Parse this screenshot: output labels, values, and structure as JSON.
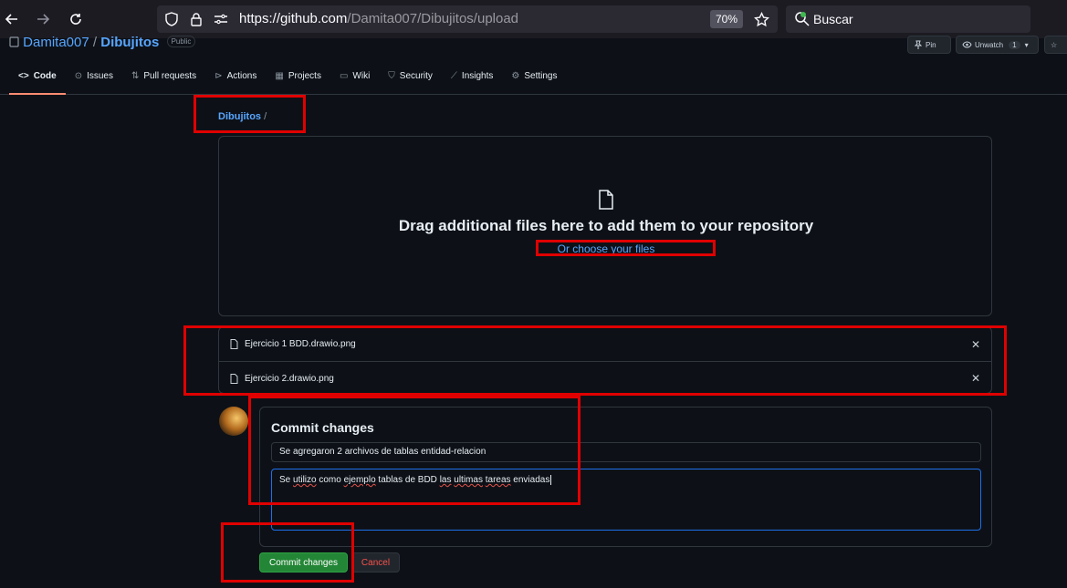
{
  "browser": {
    "url_host": "https://github.com",
    "url_path": "/Damita007/Dibujitos/upload",
    "zoom": "70%",
    "search_placeholder": "Buscar"
  },
  "repo": {
    "owner": "Damita007",
    "separator": " / ",
    "name": "Dibujitos",
    "visibility": "Public",
    "pin_label": "Pin",
    "unwatch_label": "Unwatch",
    "watch_count": "1"
  },
  "tabs": [
    {
      "label": "Code",
      "icon": "code-icon"
    },
    {
      "label": "Issues",
      "icon": "issue-icon"
    },
    {
      "label": "Pull requests",
      "icon": "pull-request-icon"
    },
    {
      "label": "Actions",
      "icon": "play-icon"
    },
    {
      "label": "Projects",
      "icon": "table-icon"
    },
    {
      "label": "Wiki",
      "icon": "book-icon"
    },
    {
      "label": "Security",
      "icon": "shield-icon"
    },
    {
      "label": "Insights",
      "icon": "graph-icon"
    },
    {
      "label": "Settings",
      "icon": "gear-icon"
    }
  ],
  "breadcrumb": {
    "repo": "Dibujitos",
    "sep": "/"
  },
  "dropzone": {
    "title": "Drag additional files here to add them to your repository",
    "subtitle": "Or choose your files"
  },
  "files": [
    {
      "name": "Ejercicio 1 BDD.drawio.png"
    },
    {
      "name": "Ejercicio 2.drawio.png"
    }
  ],
  "commit": {
    "title": "Commit changes",
    "summary": "Se agregaron 2 archivos de tablas entidad-relacion",
    "description": {
      "p1": "Se ",
      "w1": "utilizo",
      "p2": " como ",
      "w2": "ejemplo",
      "p3": " tablas de BDD ",
      "w3": "las",
      "p4": " ",
      "w4": "ultimas",
      "p5": " ",
      "w5": "tareas",
      "p6": " enviadas"
    },
    "commit_button": "Commit changes",
    "cancel_button": "Cancel"
  },
  "colors": {
    "accent": "#58a6ff",
    "commit_green": "#238636",
    "annotation_red": "#e00000"
  }
}
